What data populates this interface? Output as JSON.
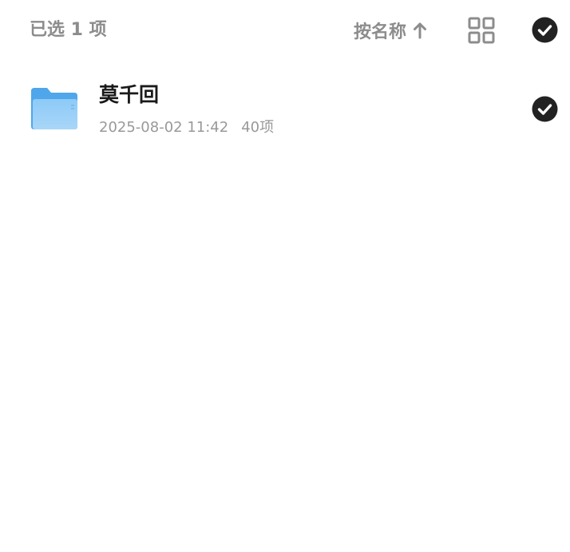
{
  "toolbar": {
    "selection_label": "已选 1 项",
    "sort_label": "按名称",
    "sort_direction_icon": "arrow-up-icon",
    "view_toggle_icon": "grid-view-icon",
    "select_all_icon": "check-circle-icon"
  },
  "files": [
    {
      "name": "莫千回",
      "modified": "2025-08-02 11:42",
      "item_count": "40项",
      "type_icon": "folder-icon",
      "selected": true,
      "check_icon": "check-circle-icon"
    }
  ],
  "colors": {
    "muted_text": "#8c8c8c",
    "meta_text": "#999999",
    "primary_text": "#1a1a1a",
    "check_fill": "#222222",
    "folder_blue": "#5fb0ee"
  }
}
